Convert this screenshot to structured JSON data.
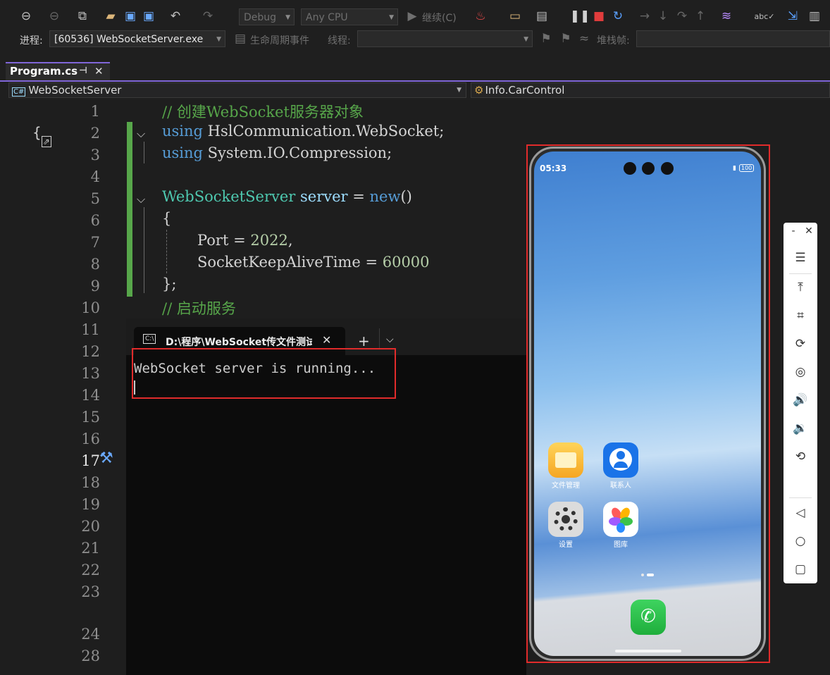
{
  "toolbar": {
    "config": "Debug",
    "platform": "Any CPU",
    "continue_label": "继续(C)",
    "process_label": "进程:",
    "process_value": "[60536] WebSocketServer.exe",
    "lifecycle_label": "生命周期事件",
    "thread_label": "线程:",
    "stackframe_label": "堆栈帧:"
  },
  "tab": {
    "title": "Program.cs"
  },
  "nav": {
    "project": "WebSocketServer",
    "member": "Info.CarControl"
  },
  "editor": {
    "line_numbers": [
      "1",
      "2",
      "3",
      "4",
      "5",
      "6",
      "7",
      "8",
      "9",
      "10",
      "11",
      "12",
      "13",
      "14",
      "15",
      "16",
      "17",
      "18",
      "19",
      "20",
      "21",
      "22",
      "23",
      "24",
      "28"
    ],
    "lines": {
      "l1": "// 创建WebSocket服务器对象",
      "l2_kw": "using",
      "l2_rest": " HslCommunication.WebSocket;",
      "l3_kw": "using",
      "l3_rest": " System.IO.Compression;",
      "l5_type": "WebSocketServer",
      "l5_var": " server",
      "l5_op": " = ",
      "l5_new": "new",
      "l5_end": "()",
      "l6": "{",
      "l7_prop": "Port",
      "l7_op": " = ",
      "l7_num": "2022",
      "l7_end": ",",
      "l8_prop": "SocketKeepAliveTime",
      "l8_op": " = ",
      "l8_num": "60000",
      "l9": "};",
      "l10": "// 启动服务"
    }
  },
  "terminal": {
    "tab_title": "D:\\程序\\WebSocket传文件测试",
    "output": "WebSocket server is running..."
  },
  "phone": {
    "time": "05:33",
    "battery": "100",
    "apps": [
      {
        "label": "文件管理"
      },
      {
        "label": "联系人"
      },
      {
        "label": "设置"
      },
      {
        "label": "图库"
      }
    ]
  },
  "colors": {
    "accent": "#8066d8",
    "highlight_box": "#e12b2b",
    "comment": "#57a64a",
    "keyword": "#569cd6",
    "type": "#4ec9b0"
  }
}
